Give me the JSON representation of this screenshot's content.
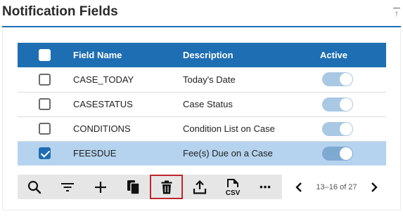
{
  "panel": {
    "title": "Notification Fields"
  },
  "table": {
    "headers": {
      "field_name": "Field Name",
      "description": "Description",
      "active": "Active"
    },
    "rows": [
      {
        "field_name": "CASE_TODAY",
        "description": "Today's Date",
        "active": true,
        "checked": false
      },
      {
        "field_name": "CASESTATUS",
        "description": "Case Status",
        "active": true,
        "checked": false
      },
      {
        "field_name": "CONDITIONS",
        "description": "Condition List on Case",
        "active": true,
        "checked": false
      },
      {
        "field_name": "FEESDUE",
        "description": "Fee(s) Due on a Case",
        "active": true,
        "checked": true
      }
    ]
  },
  "toolbar": {
    "icons": [
      "search-icon",
      "filter-icon",
      "add-icon",
      "copy-icon",
      "delete-icon",
      "export-icon",
      "csv-icon",
      "more-icon"
    ],
    "csv_label": "CSV",
    "more_label": "•••"
  },
  "pager": {
    "range": "13–16 of 27"
  },
  "colors": {
    "header_bg": "#1e6eb4",
    "selected_row_bg": "#b5d3ee",
    "toggle_on": "#a9c8e3",
    "highlight_outline": "#c0262d",
    "toolbar_bg": "#e6e6e6"
  }
}
